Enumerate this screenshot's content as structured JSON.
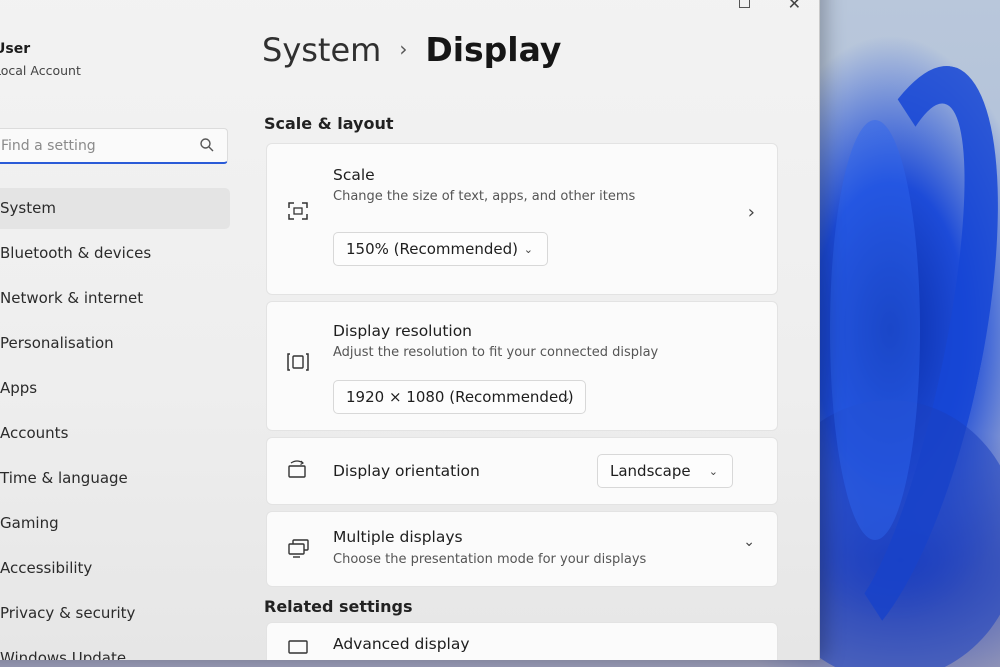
{
  "window": {
    "caption_buttons": [
      "maximize",
      "close"
    ]
  },
  "sidebar": {
    "user_name": "User",
    "user_type": "Local Account",
    "search_placeholder": "Find a setting",
    "items": [
      {
        "label": "System",
        "active": true
      },
      {
        "label": "Bluetooth & devices"
      },
      {
        "label": "Network & internet"
      },
      {
        "label": "Personalisation"
      },
      {
        "label": "Apps"
      },
      {
        "label": "Accounts"
      },
      {
        "label": "Time & language"
      },
      {
        "label": "Gaming"
      },
      {
        "label": "Accessibility"
      },
      {
        "label": "Privacy & security"
      },
      {
        "label": "Windows Update"
      }
    ]
  },
  "main": {
    "breadcrumb_parent": "System",
    "breadcrumb_sep": "›",
    "breadcrumb_current": "Display",
    "section_scale_layout": "Scale & layout",
    "scale": {
      "title": "Scale",
      "subtitle": "Change the size of text, apps, and other items",
      "value": "150% (Recommended)"
    },
    "resolution": {
      "title": "Display resolution",
      "subtitle": "Adjust the resolution to fit your connected display",
      "value": "1920 × 1080 (Recommended)"
    },
    "orientation": {
      "title": "Display orientation",
      "value": "Landscape"
    },
    "multiple": {
      "title": "Multiple displays",
      "subtitle": "Choose the presentation mode for your displays"
    },
    "section_related": "Related settings",
    "advanced": {
      "title": "Advanced display"
    }
  },
  "colors": {
    "accent": "#2a5bd7",
    "wallpaper_blue": "#1d4bd8"
  }
}
